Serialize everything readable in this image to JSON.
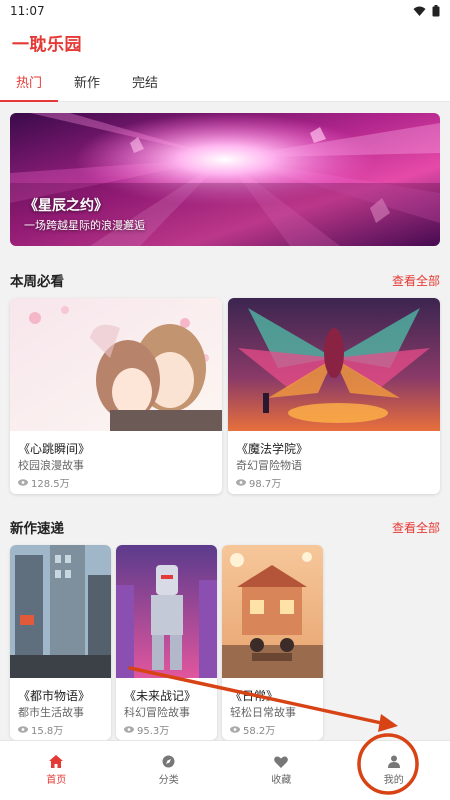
{
  "status_bar": {
    "time": "11:07",
    "wifi_icon": "wifi-icon",
    "battery_icon": "battery-icon"
  },
  "header": {
    "title": "一耽乐园"
  },
  "tabs": [
    {
      "label": "热门",
      "active": true
    },
    {
      "label": "新作",
      "active": false
    },
    {
      "label": "完结",
      "active": false
    }
  ],
  "banner": {
    "title": "《星辰之约》",
    "subtitle": "一场跨越星际的浪漫邂逅"
  },
  "weekly": {
    "title": "本周必看",
    "see_all": "查看全部",
    "items": [
      {
        "title": "《心跳瞬间》",
        "genre": "校园浪漫故事",
        "views": "128.5万"
      },
      {
        "title": "《魔法学院》",
        "genre": "奇幻冒险物语",
        "views": "98.7万"
      }
    ]
  },
  "new_releases": {
    "title": "新作速递",
    "see_all": "查看全部",
    "items": [
      {
        "title": "《都市物语》",
        "genre": "都市生活故事",
        "views": "15.8万"
      },
      {
        "title": "《未来战记》",
        "genre": "科幻冒险故事",
        "views": "95.3万"
      },
      {
        "title": "《日常》",
        "genre": "轻松日常故事",
        "views": "58.2万"
      }
    ]
  },
  "bottom_nav": [
    {
      "label": "首页",
      "icon": "home-icon",
      "active": true
    },
    {
      "label": "分类",
      "icon": "category-icon",
      "active": false
    },
    {
      "label": "收藏",
      "icon": "heart-icon",
      "active": false
    },
    {
      "label": "我的",
      "icon": "user-icon",
      "active": false
    }
  ],
  "colors": {
    "accent": "#e53935",
    "annotation": "#d84315"
  }
}
